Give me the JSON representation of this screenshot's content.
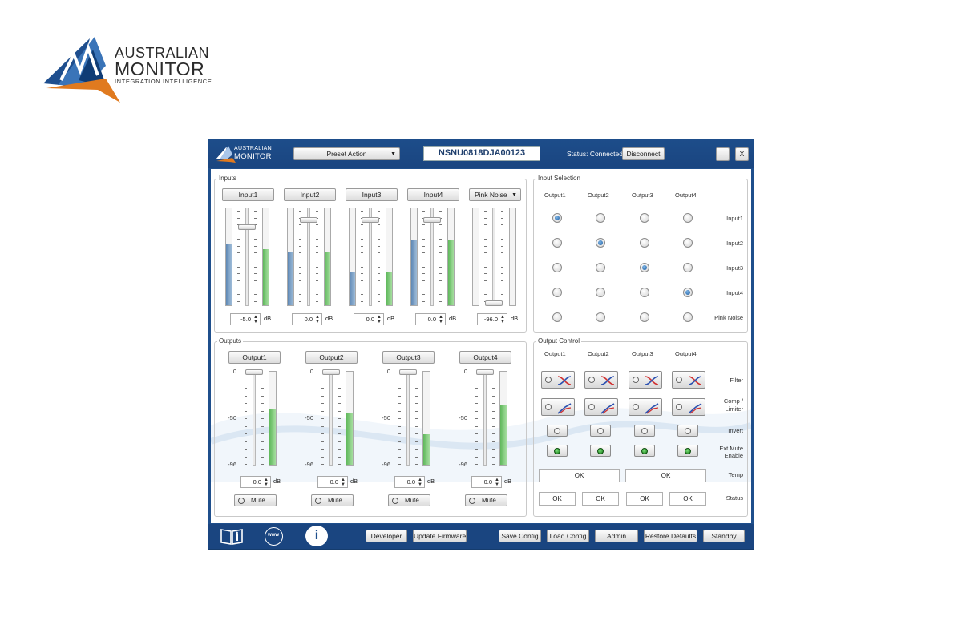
{
  "brand": {
    "line1": "AUSTRALIAN",
    "line2": "MONITOR",
    "line3": "INTEGRATION INTELLIGENCE"
  },
  "titlebar": {
    "logo_line1": "AUSTRALIAN",
    "logo_line2": "MONITOR",
    "preset_action": "Preset Action",
    "device_id": "NSNU0818DJA00123",
    "status": "Status: Connected",
    "disconnect": "Disconnect",
    "minimize": "_",
    "close": "X"
  },
  "inputs": {
    "title": "Inputs",
    "channels": [
      {
        "label": "Input1",
        "value": "-5.0",
        "unit": "dB",
        "level_a": 0.64,
        "level_b": 0.58,
        "fader": 0.82
      },
      {
        "label": "Input2",
        "value": "0.0",
        "unit": "dB",
        "level_a": 0.55,
        "level_b": 0.55,
        "fader": 0.9
      },
      {
        "label": "Input3",
        "value": "0.0",
        "unit": "dB",
        "level_a": 0.35,
        "level_b": 0.35,
        "fader": 0.9
      },
      {
        "label": "Input4",
        "value": "0.0",
        "unit": "dB",
        "level_a": 0.67,
        "level_b": 0.67,
        "fader": 0.9
      },
      {
        "label": "Pink Noise",
        "value": "-96.0",
        "unit": "dB",
        "level_a": 0.0,
        "level_b": 0.0,
        "fader": 0.0,
        "dropdown": true
      }
    ]
  },
  "outputs": {
    "title": "Outputs",
    "scale": [
      "0",
      "-50",
      "-96"
    ],
    "channels": [
      {
        "label": "Output1",
        "value": "0.0",
        "unit": "dB",
        "level": 0.6,
        "fader": 1.0,
        "mute": "Mute"
      },
      {
        "label": "Output2",
        "value": "0.0",
        "unit": "dB",
        "level": 0.56,
        "fader": 1.0,
        "mute": "Mute"
      },
      {
        "label": "Output3",
        "value": "0.0",
        "unit": "dB",
        "level": 0.33,
        "fader": 1.0,
        "mute": "Mute"
      },
      {
        "label": "Output4",
        "value": "0.0",
        "unit": "dB",
        "level": 0.65,
        "fader": 1.0,
        "mute": "Mute"
      }
    ]
  },
  "input_selection": {
    "title": "Input Selection",
    "columns": [
      "Output1",
      "Output2",
      "Output3",
      "Output4"
    ],
    "rows": [
      "Input1",
      "Input2",
      "Input3",
      "Input4",
      "Pink Noise"
    ],
    "selected": [
      0,
      1,
      2,
      3
    ]
  },
  "output_control": {
    "title": "Output Control",
    "columns": [
      "Output1",
      "Output2",
      "Output3",
      "Output4"
    ],
    "row_labels": {
      "filter": "Filter",
      "comp_1": "Comp /",
      "comp_2": "Limiter",
      "invert": "Invert",
      "extmute_1": "Ext Mute",
      "extmute_2": "Enable",
      "temp": "Temp",
      "status": "Status"
    },
    "temp_values": [
      "OK",
      "OK"
    ],
    "status_values": [
      "OK",
      "OK",
      "OK",
      "OK"
    ]
  },
  "bottombar": {
    "developer": "Developer",
    "update_firmware": "Update Firmware",
    "save_config": "Save Config",
    "load_config": "Load Config",
    "admin": "Admin",
    "restore_defaults": "Restore Defaults",
    "standby": "Standby",
    "www": "www",
    "info": "i"
  },
  "colors": {
    "window_blue": "#1f4f8c",
    "meter_blue": "#6f98c3",
    "meter_green": "#6cc46a",
    "logo_orange": "#e07a1f"
  }
}
